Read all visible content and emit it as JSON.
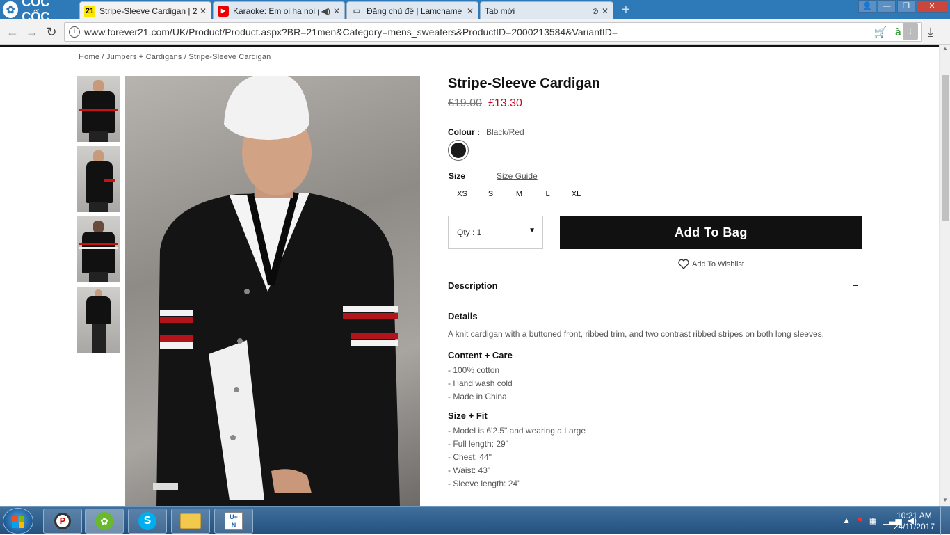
{
  "browser": {
    "brand": "CỐC CỐC",
    "tabs": [
      {
        "title": "Stripe-Sleeve Cardigan | 2",
        "favicon": "21"
      },
      {
        "title": "Karaoke: Em oi ha noi p",
        "favicon": "▶"
      },
      {
        "title": "Đăng chủ đề | Lamchame",
        "favicon": "▭"
      },
      {
        "title": "Tab mới",
        "favicon": ""
      }
    ],
    "url": "www.forever21.com/UK/Product/Product.aspx?BR=21men&Category=mens_sweaters&ProductID=2000213584&VariantID="
  },
  "breadcrumb": [
    "Home",
    "Jumpers + Cardigans",
    "Stripe-Sleeve Cardigan"
  ],
  "product": {
    "title": "Stripe-Sleeve Cardigan",
    "price_old": "£19.00",
    "price_new": "£13.30",
    "colour_label": "Colour :",
    "colour_value": "Black/Red",
    "size_label": "Size",
    "size_guide": "Size Guide",
    "sizes": [
      "XS",
      "S",
      "M",
      "L",
      "XL"
    ],
    "qty_label": "Qty : 1",
    "add_to_bag": "Add To Bag",
    "wishlist": "Add To Wishlist",
    "description_heading": "Description",
    "collapse_symbol": "–",
    "details_heading": "Details",
    "details_text": "A knit cardigan with a buttoned front, ribbed trim, and two contrast ribbed stripes on both long sleeves.",
    "care_heading": "Content + Care",
    "care_items": [
      "- 100% cotton",
      "- Hand wash cold",
      "- Made in China"
    ],
    "fit_heading": "Size + Fit",
    "fit_items": [
      "- Model is 6'2.5\" and wearing a Large",
      "- Full length: 29\"",
      "- Chest: 44\"",
      "- Waist: 43\"",
      "- Sleeve length: 24\""
    ]
  },
  "taskbar": {
    "time": "10:21 AM",
    "date": "24/11/2017"
  }
}
